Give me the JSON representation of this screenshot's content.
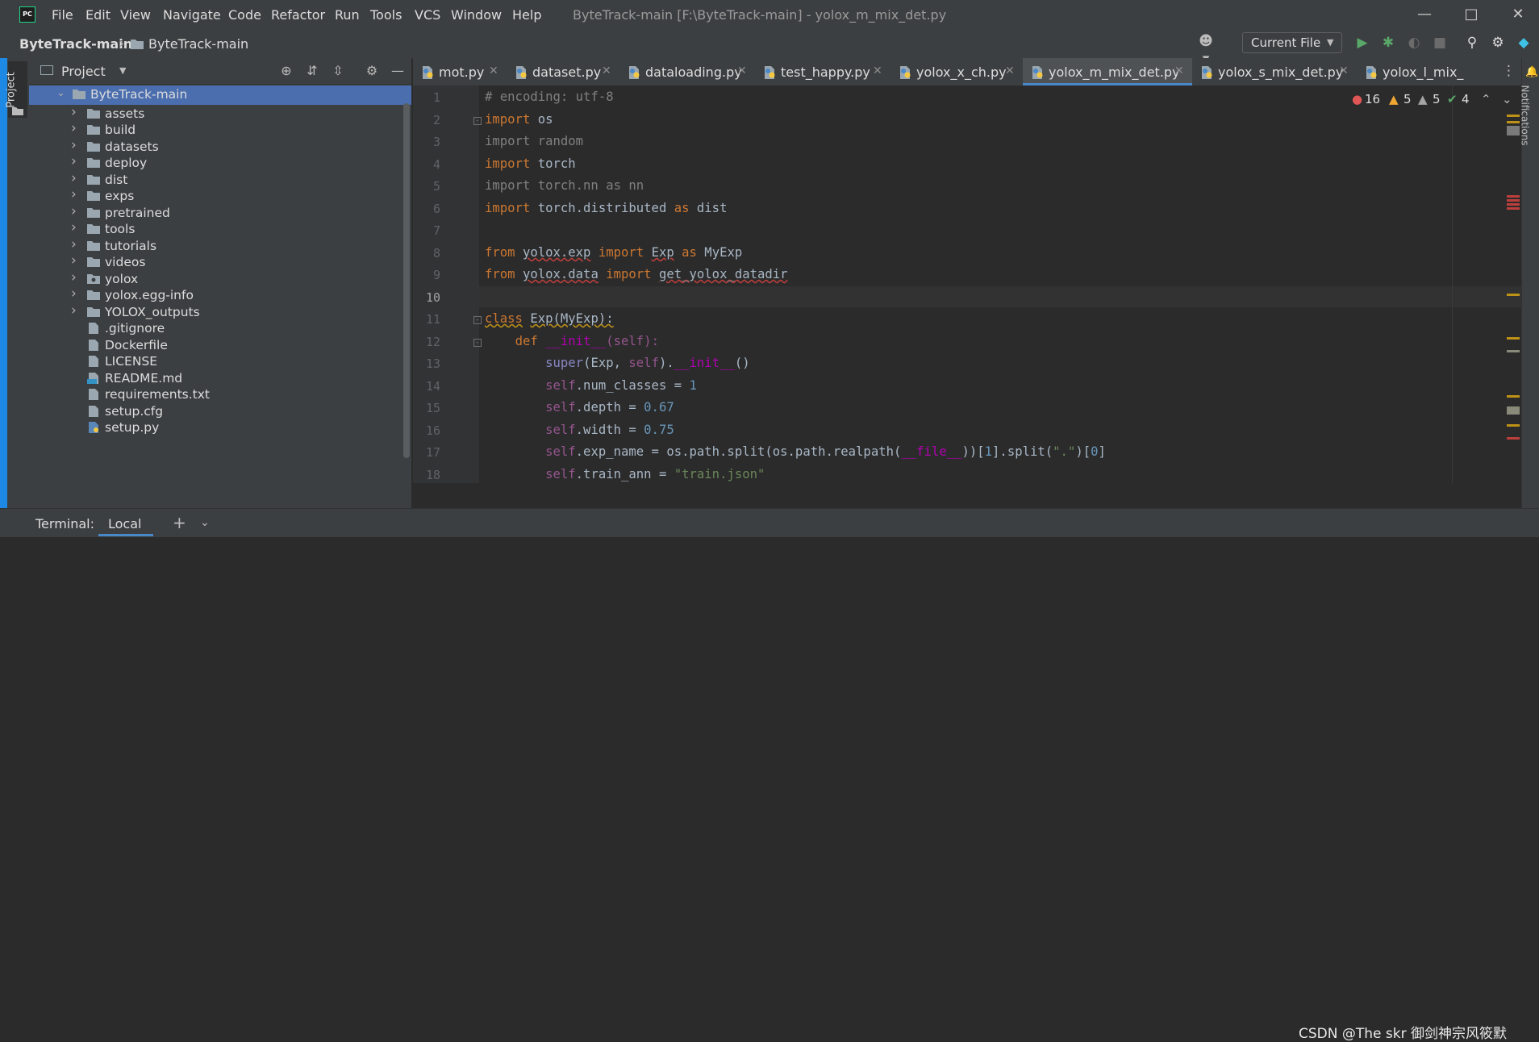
{
  "menu": [
    "File",
    "Edit",
    "View",
    "Navigate",
    "Code",
    "Refactor",
    "Run",
    "Tools",
    "VCS",
    "Window",
    "Help"
  ],
  "window_title": "ByteTrack-main [F:\\ByteTrack-main] - yolox_m_mix_det.py",
  "app_logo": "PC",
  "breadcrumb": {
    "root": "ByteTrack-main",
    "child": "ByteTrack-main"
  },
  "run_config": "Current File",
  "project_panel": {
    "title": "Project",
    "strip_label": "Project",
    "root": "ByteTrack-main",
    "items": [
      {
        "label": "assets",
        "type": "folder"
      },
      {
        "label": "build",
        "type": "folder"
      },
      {
        "label": "datasets",
        "type": "folder"
      },
      {
        "label": "deploy",
        "type": "folder"
      },
      {
        "label": "dist",
        "type": "folder"
      },
      {
        "label": "exps",
        "type": "folder"
      },
      {
        "label": "pretrained",
        "type": "folder"
      },
      {
        "label": "tools",
        "type": "folder"
      },
      {
        "label": "tutorials",
        "type": "folder"
      },
      {
        "label": "videos",
        "type": "folder"
      },
      {
        "label": "yolox",
        "type": "package"
      },
      {
        "label": "yolox.egg-info",
        "type": "folder"
      },
      {
        "label": "YOLOX_outputs",
        "type": "folder"
      },
      {
        "label": ".gitignore",
        "type": "file"
      },
      {
        "label": "Dockerfile",
        "type": "file"
      },
      {
        "label": "LICENSE",
        "type": "file"
      },
      {
        "label": "README.md",
        "type": "md"
      },
      {
        "label": "requirements.txt",
        "type": "file"
      },
      {
        "label": "setup.cfg",
        "type": "file"
      },
      {
        "label": "setup.py",
        "type": "py"
      }
    ]
  },
  "tabs": [
    "mot.py",
    "dataset.py",
    "dataloading.py",
    "test_happy.py",
    "yolox_x_ch.py",
    "yolox_m_mix_det.py",
    "yolox_s_mix_det.py",
    "yolox_l_mix_"
  ],
  "active_tab": "yolox_m_mix_det.py",
  "line_numbers": [
    "1",
    "2",
    "3",
    "4",
    "5",
    "6",
    "7",
    "8",
    "9",
    "10",
    "11",
    "12",
    "13",
    "14",
    "15",
    "16",
    "17",
    "18"
  ],
  "code": {
    "l1": "# encoding: utf-8",
    "kw_import": "import",
    "kw_from": "from",
    "kw_as": "as",
    "kw_class": "class",
    "kw_def": "def",
    "self": "self",
    "l2_mod": " os",
    "l3": "import random",
    "l4_mod": " torch",
    "l5": "import torch.nn as nn",
    "l6_mod": " torch.distributed ",
    "l6_alias": " dist",
    "l8_mod": "yolox.exp",
    "l8_name": "Exp",
    "l8_alias": " MyExp",
    "l9_mod": "yolox.data",
    "l9_name": "get_yolox_datadir",
    "l11_rest": "Exp(MyExp):",
    "l12_name": "__init__",
    "l12_rest": "(self):",
    "l13_super": "super",
    "l13_a": "(Exp, ",
    "l13_b": ").",
    "l13_init": "__init__",
    "l13_c": "()",
    "l14_attr": ".num_classes = ",
    "l14_val": "1",
    "l15_attr": ".depth = ",
    "l15_val": "0.67",
    "l16_attr": ".width = ",
    "l16_val": "0.75",
    "l17_a": ".exp_name = os.path.split(os.path.realpath(",
    "l17_file": "__file__",
    "l17_b": "))[",
    "l17_n1": "1",
    "l17_c": "].split(",
    "l17_s": "\".\"",
    "l17_d": ")[",
    "l17_n2": "0",
    "l17_e": "]",
    "l18_attr": ".train_ann = ",
    "l18_val": "\"train.json\""
  },
  "inspections": {
    "errors": "16",
    "warnings": "5",
    "weak_warnings": "5",
    "typos": "4"
  },
  "notifications_label": "Notifications",
  "terminal": {
    "label": "Terminal:",
    "tab": "Local"
  },
  "watermark": "CSDN @The skr 御剑神宗风筱默",
  "colors": {
    "accent": "#4a88c7",
    "selection": "#4b6eaf",
    "keyword": "#cc7832",
    "string": "#6a8759",
    "number": "#6897bb",
    "self": "#94558d",
    "error": "#bc3f3c"
  }
}
